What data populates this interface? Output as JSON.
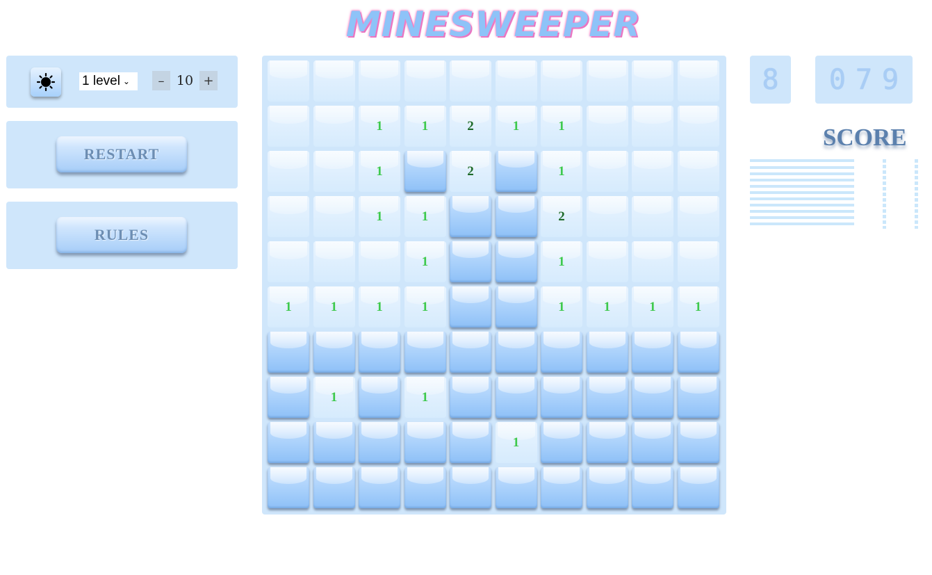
{
  "title": "MINESWEEPER",
  "controls": {
    "theme_icon": "sun-icon",
    "level_value": "1 level",
    "decrement_label": "–",
    "increment_label": "+",
    "mine_count": "10"
  },
  "buttons": {
    "restart_label": "RESTART",
    "rules_label": "RULES"
  },
  "counters": {
    "mines_left": "8",
    "timer": "079"
  },
  "score": {
    "title": "SCORE"
  },
  "board": {
    "rows": [
      [
        "o",
        "o",
        "o",
        "o",
        "o",
        "o",
        "o",
        "o",
        "o",
        "o"
      ],
      [
        "o",
        "o",
        "1",
        "1",
        "2",
        "1",
        "1",
        "o",
        "o",
        "o"
      ],
      [
        "o",
        "o",
        "1",
        "c",
        "2",
        "c",
        "1",
        "o",
        "o",
        "o"
      ],
      [
        "o",
        "o",
        "1",
        "1",
        "c",
        "c",
        "2",
        "o",
        "o",
        "o"
      ],
      [
        "o",
        "o",
        "o",
        "1",
        "c",
        "c",
        "1",
        "o",
        "o",
        "o"
      ],
      [
        "1",
        "1",
        "1",
        "1",
        "c",
        "c",
        "1",
        "1",
        "1",
        "1"
      ],
      [
        "c",
        "c",
        "c",
        "c",
        "c",
        "c",
        "c",
        "c",
        "c",
        "c"
      ],
      [
        "c",
        "1",
        "c",
        "1",
        "c",
        "c",
        "c",
        "c",
        "c",
        "c"
      ],
      [
        "c",
        "c",
        "c",
        "c",
        "c",
        "1",
        "c",
        "c",
        "c",
        "c"
      ],
      [
        "c",
        "c",
        "c",
        "c",
        "c",
        "c",
        "c",
        "c",
        "c",
        "c"
      ]
    ]
  },
  "colors": {
    "panel": "#cfe6fb",
    "number_1": "#3ec94d",
    "number_2": "#1f6b2a",
    "title": "#8ec3f8"
  }
}
